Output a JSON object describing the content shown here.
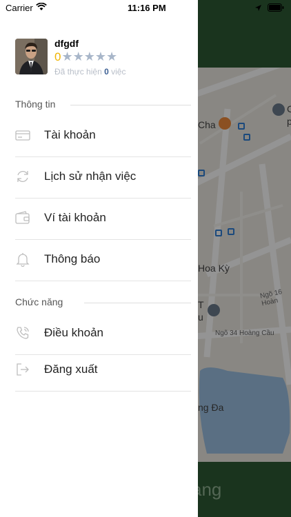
{
  "status_bar": {
    "carrier": "Carrier",
    "time": "11:16 PM"
  },
  "profile": {
    "username": "dfgdf",
    "rating": "0",
    "stars": "★★★★★",
    "jobs_prefix": "Đã thực hiện",
    "jobs_count": "0",
    "jobs_suffix": "việc"
  },
  "sections": {
    "info_title": "Thông tin",
    "function_title": "Chức năng"
  },
  "menu": {
    "account": "Tài khoản",
    "history": "Lịch sử nhận việc",
    "wallet": "Ví tài khoản",
    "notifications": "Thông báo",
    "terms": "Điều khoản",
    "logout": "Đăng xuất"
  },
  "background": {
    "poi_cha": "Cha",
    "poi_hoa_ky": "Hoa Kỳ",
    "poi_t": "T",
    "poi_u": "u",
    "poi_ng_da": "ng Đa",
    "poi_c": "C",
    "poi_p": "p",
    "street_16": "Ngõ 16 Hoàn",
    "street_34": "Ngõ 34 Hoàng Cầu",
    "bottom_text": "àng"
  },
  "colors": {
    "brand_green": "#2e5a34",
    "star_gold": "#f0b400",
    "star_grey": "#a8b6c9",
    "count_blue": "#3b5f93"
  }
}
